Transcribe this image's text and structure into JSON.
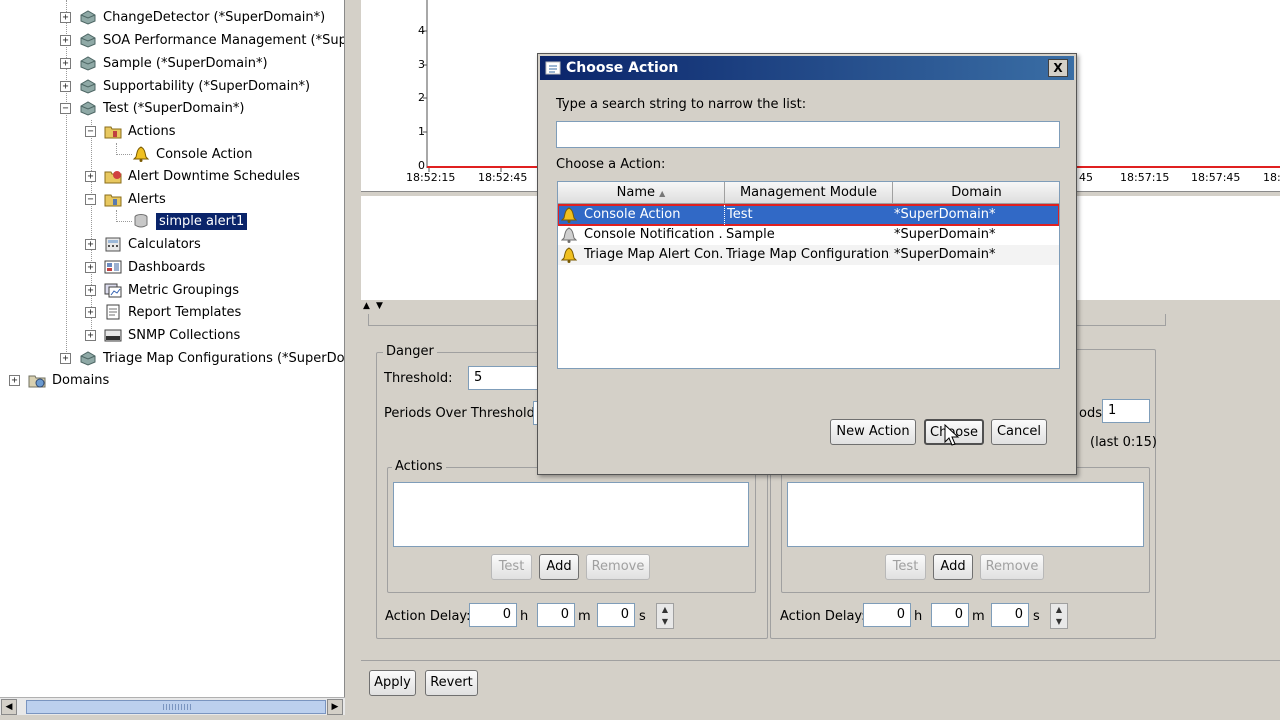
{
  "tree": {
    "items": [
      {
        "label": "ChangeDetector (*SuperDomain*)"
      },
      {
        "label": "SOA Performance Management (*Super"
      },
      {
        "label": "Sample (*SuperDomain*)"
      },
      {
        "label": "Supportability (*SuperDomain*)"
      },
      {
        "label": "Test (*SuperDomain*)"
      },
      {
        "label": "Actions"
      },
      {
        "label": "Console Action"
      },
      {
        "label": "Alert Downtime Schedules"
      },
      {
        "label": "Alerts"
      },
      {
        "label": "simple alert1"
      },
      {
        "label": "Calculators"
      },
      {
        "label": "Dashboards"
      },
      {
        "label": "Metric Groupings"
      },
      {
        "label": "Report Templates"
      },
      {
        "label": "SNMP Collections"
      },
      {
        "label": "Triage Map Configurations (*SuperDom"
      },
      {
        "label": "Domains"
      }
    ]
  },
  "chart": {
    "y_ticks": [
      "4",
      "3",
      "2",
      "1",
      "0"
    ],
    "x_ticks_left": [
      "18:52:15",
      "18:52:45"
    ],
    "x_ticks_right": [
      "45",
      "18:57:15",
      "18:57:45",
      "18:"
    ],
    "line_color": "#e02020"
  },
  "danger": {
    "title": "Danger",
    "threshold_label": "Threshold:",
    "threshold_value": "5",
    "periods_label": "Periods Over Threshold:",
    "actions_title": "Actions",
    "test_label": "Test",
    "add_label": "Add",
    "remove_label": "Remove",
    "delay_label": "Action Delay:",
    "delay_h": "0",
    "delay_m": "0",
    "delay_s": "0",
    "unit_h": "h",
    "unit_m": "m",
    "unit_s": "s"
  },
  "caution": {
    "periods_label_tail": "ods:",
    "periods_value": "1",
    "last_label": "(last 0:15)",
    "test_label": "Test",
    "add_label": "Add",
    "remove_label": "Remove",
    "delay_label": "Action Delay:",
    "delay_h": "0",
    "delay_m": "0",
    "delay_s": "0",
    "unit_h": "h",
    "unit_m": "m",
    "unit_s": "s"
  },
  "footer": {
    "apply_label": "Apply",
    "revert_label": "Revert"
  },
  "dialog": {
    "title": "Choose Action",
    "search_label": "Type a search string to narrow the list:",
    "search_value": "",
    "list_label": "Choose a Action:",
    "columns": [
      "Name",
      "Management Module",
      "Domain"
    ],
    "rows": [
      {
        "name": "Console Action",
        "module": "Test",
        "domain": "*SuperDomain*"
      },
      {
        "name": "Console Notification ...",
        "module": "Sample",
        "domain": "*SuperDomain*"
      },
      {
        "name": "Triage Map Alert Con...",
        "module": "Triage Map Configurations",
        "domain": "*SuperDomain*"
      }
    ],
    "new_action_label": "New Action",
    "choose_label": "Choose",
    "cancel_label": "Cancel",
    "close_label": "X"
  }
}
